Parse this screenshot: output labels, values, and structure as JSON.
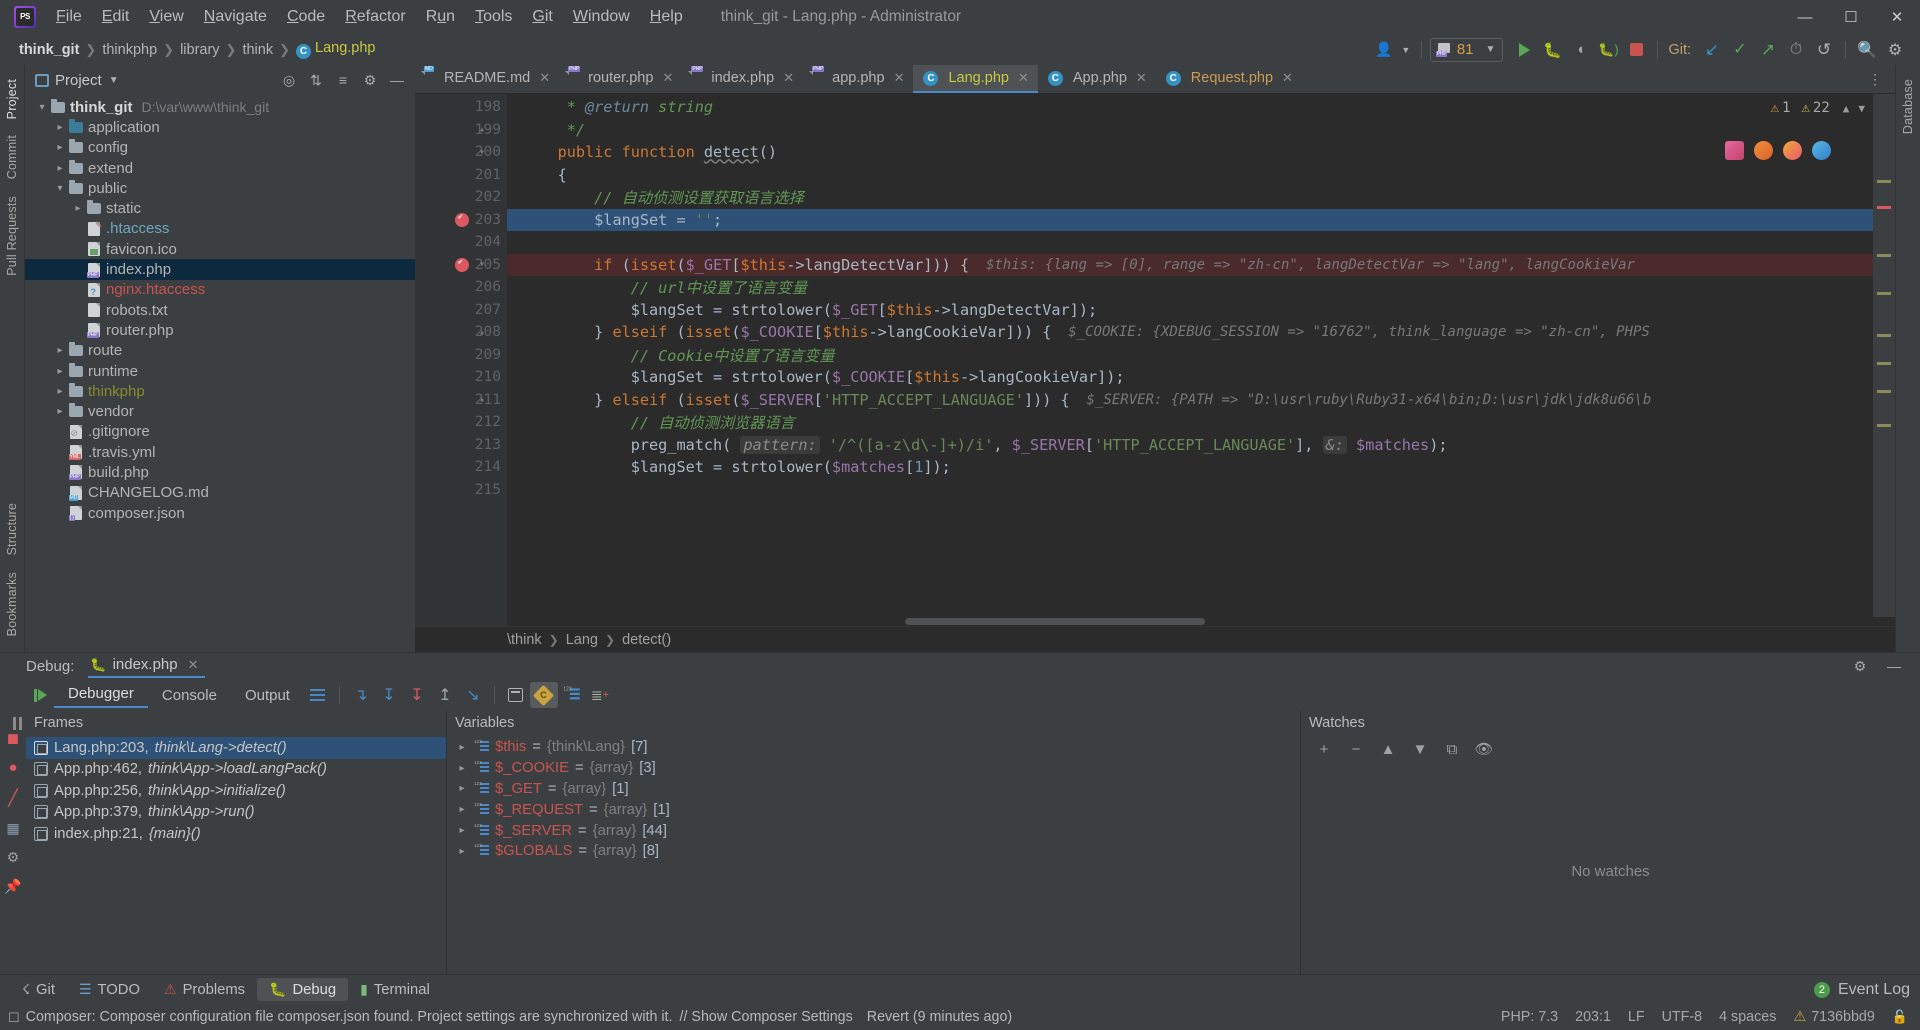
{
  "window": {
    "title": "think_git - Lang.php - Administrator",
    "controls": [
      "minimize",
      "maximize",
      "close"
    ]
  },
  "menu": [
    "File",
    "Edit",
    "View",
    "Navigate",
    "Code",
    "Refactor",
    "Run",
    "Tools",
    "Git",
    "Window",
    "Help"
  ],
  "breadcrumb": {
    "items": [
      "think_git",
      "thinkphp",
      "library",
      "think",
      "Lang.php"
    ],
    "file_badge": "C"
  },
  "toolbar": {
    "run_config": "81",
    "git_label": "Git:",
    "icons": [
      "user-avatar-icon",
      "run-icon",
      "debug-icon",
      "coverage-icon",
      "profile-icon",
      "stop-icon",
      "git-update-icon",
      "git-commit-icon",
      "git-push-icon",
      "history-icon",
      "rollback-icon",
      "search-icon",
      "settings-icon"
    ]
  },
  "left_strip": [
    "Project",
    "Commit",
    "Pull Requests"
  ],
  "right_strip": [
    "Database"
  ],
  "bottom_left_strip": [
    "Structure",
    "Bookmarks"
  ],
  "project_panel": {
    "title": "Project",
    "tree": [
      {
        "depth": 0,
        "chev": "open",
        "icon": "folder",
        "label": "think_git",
        "style": "bold",
        "path": "D:\\var\\www\\think_git"
      },
      {
        "depth": 1,
        "chev": "closed",
        "icon": "folder-blue",
        "label": "application",
        "style": ""
      },
      {
        "depth": 1,
        "chev": "closed",
        "icon": "folder",
        "label": "config",
        "style": ""
      },
      {
        "depth": 1,
        "chev": "closed",
        "icon": "folder",
        "label": "extend",
        "style": ""
      },
      {
        "depth": 1,
        "chev": "open",
        "icon": "folder",
        "label": "public",
        "style": ""
      },
      {
        "depth": 2,
        "chev": "closed",
        "icon": "folder",
        "label": "static",
        "style": ""
      },
      {
        "depth": 2,
        "chev": "none",
        "icon": "file-htaccess",
        "label": ".htaccess",
        "style": "cyan"
      },
      {
        "depth": 2,
        "chev": "none",
        "icon": "file-img",
        "label": "favicon.ico",
        "style": ""
      },
      {
        "depth": 2,
        "chev": "none",
        "icon": "file-php",
        "label": "index.php",
        "style": "",
        "selected": true
      },
      {
        "depth": 2,
        "chev": "none",
        "icon": "file-unknown",
        "label": "nginx.htaccess",
        "style": "red"
      },
      {
        "depth": 2,
        "chev": "none",
        "icon": "file-txt",
        "label": "robots.txt",
        "style": ""
      },
      {
        "depth": 2,
        "chev": "none",
        "icon": "file-php",
        "label": "router.php",
        "style": ""
      },
      {
        "depth": 1,
        "chev": "closed",
        "icon": "folder",
        "label": "route",
        "style": ""
      },
      {
        "depth": 1,
        "chev": "closed",
        "icon": "folder",
        "label": "runtime",
        "style": ""
      },
      {
        "depth": 1,
        "chev": "closed",
        "icon": "folder",
        "label": "thinkphp",
        "style": "yellow"
      },
      {
        "depth": 1,
        "chev": "closed",
        "icon": "folder",
        "label": "vendor",
        "style": ""
      },
      {
        "depth": 1,
        "chev": "none",
        "icon": "file-git",
        "label": ".gitignore",
        "style": ""
      },
      {
        "depth": 1,
        "chev": "none",
        "icon": "file-yml",
        "label": ".travis.yml",
        "style": ""
      },
      {
        "depth": 1,
        "chev": "none",
        "icon": "file-php",
        "label": "build.php",
        "style": ""
      },
      {
        "depth": 1,
        "chev": "none",
        "icon": "file-md",
        "label": "CHANGELOG.md",
        "style": ""
      },
      {
        "depth": 1,
        "chev": "none",
        "icon": "file-json",
        "label": "composer.json",
        "style": ""
      }
    ]
  },
  "editor": {
    "tabs": [
      {
        "label": "README.md",
        "icon": "file-md",
        "color": "default",
        "active": false
      },
      {
        "label": "router.php",
        "icon": "file-php",
        "color": "default",
        "active": false
      },
      {
        "label": "index.php",
        "icon": "file-php",
        "color": "default",
        "active": false
      },
      {
        "label": "app.php",
        "icon": "file-php",
        "color": "default",
        "active": false
      },
      {
        "label": "Lang.php",
        "icon": "class-c",
        "color": "yellow",
        "active": true
      },
      {
        "label": "App.php",
        "icon": "class-c",
        "color": "default",
        "active": false
      },
      {
        "label": "Request.php",
        "icon": "class-c",
        "color": "orange",
        "active": false
      }
    ],
    "inspection": {
      "warnings": "1",
      "weak_warnings": "22"
    },
    "first_line": 198,
    "lines": [
      {
        "n": 198,
        "fold": "",
        "bp": false,
        "state": "",
        "tokens": [
          {
            "t": "     * ",
            "c": "cmt"
          },
          {
            "t": "@return",
            "c": "hint-k"
          },
          {
            "t": " string",
            "c": "cmt"
          }
        ]
      },
      {
        "n": 199,
        "fold": "end",
        "bp": false,
        "state": "",
        "tokens": [
          {
            "t": "     */",
            "c": "cmt"
          }
        ]
      },
      {
        "n": 200,
        "fold": "start",
        "bp": false,
        "state": "",
        "tokens": [
          {
            "t": "    ",
            "c": "txt"
          },
          {
            "t": "public function ",
            "c": "k"
          },
          {
            "t": "detect",
            "c": "fn-und"
          },
          {
            "t": "()",
            "c": "txt"
          }
        ]
      },
      {
        "n": 201,
        "fold": "",
        "bp": false,
        "state": "",
        "tokens": [
          {
            "t": "    {",
            "c": "txt"
          }
        ]
      },
      {
        "n": 202,
        "fold": "",
        "bp": false,
        "state": "",
        "tokens": [
          {
            "t": "        // 自动侦测设置获取语言选择",
            "c": "cmt"
          }
        ]
      },
      {
        "n": 203,
        "fold": "",
        "bp": true,
        "state": "cur",
        "tokens": [
          {
            "t": "        ",
            "c": "txt"
          },
          {
            "t": "$langSet",
            "c": "txt"
          },
          {
            "t": " = ",
            "c": "txt"
          },
          {
            "t": "''",
            "c": "str"
          },
          {
            "t": ";",
            "c": "txt"
          }
        ]
      },
      {
        "n": 204,
        "fold": "",
        "bp": false,
        "state": "",
        "tokens": []
      },
      {
        "n": 205,
        "fold": "start",
        "bp": true,
        "state": "exec",
        "tokens": [
          {
            "t": "        ",
            "c": "txt"
          },
          {
            "t": "if",
            "c": "k"
          },
          {
            "t": " (",
            "c": "txt"
          },
          {
            "t": "isset",
            "c": "k"
          },
          {
            "t": "(",
            "c": "txt"
          },
          {
            "t": "$_GET",
            "c": "var"
          },
          {
            "t": "[",
            "c": "txt"
          },
          {
            "t": "$this",
            "c": "k"
          },
          {
            "t": "->langDetectVar])) {",
            "c": "txt"
          },
          {
            "t": "  $this: {lang => [0], range => \"zh-cn\", langDetectVar => \"lang\", langCookieVar",
            "c": "hint"
          }
        ]
      },
      {
        "n": 206,
        "fold": "",
        "bp": false,
        "state": "",
        "tokens": [
          {
            "t": "            // url中设置了语言变量",
            "c": "cmt"
          }
        ]
      },
      {
        "n": 207,
        "fold": "",
        "bp": false,
        "state": "",
        "tokens": [
          {
            "t": "            ",
            "c": "txt"
          },
          {
            "t": "$langSet",
            "c": "txt"
          },
          {
            "t": " = ",
            "c": "txt"
          },
          {
            "t": "strtolower",
            "c": "txt"
          },
          {
            "t": "(",
            "c": "txt"
          },
          {
            "t": "$_GET",
            "c": "var"
          },
          {
            "t": "[",
            "c": "txt"
          },
          {
            "t": "$this",
            "c": "k"
          },
          {
            "t": "->langDetectVar]);",
            "c": "txt"
          }
        ]
      },
      {
        "n": 208,
        "fold": "end",
        "bp": false,
        "state": "",
        "tokens": [
          {
            "t": "        } ",
            "c": "txt"
          },
          {
            "t": "elseif",
            "c": "k"
          },
          {
            "t": " (",
            "c": "txt"
          },
          {
            "t": "isset",
            "c": "k"
          },
          {
            "t": "(",
            "c": "txt"
          },
          {
            "t": "$_COOKIE",
            "c": "var"
          },
          {
            "t": "[",
            "c": "txt"
          },
          {
            "t": "$this",
            "c": "k"
          },
          {
            "t": "->langCookieVar])) {",
            "c": "txt"
          },
          {
            "t": "  $_COOKIE: {XDEBUG_SESSION => \"16762\", think_language => \"zh-cn\", PHPS",
            "c": "hint"
          }
        ]
      },
      {
        "n": 209,
        "fold": "",
        "bp": false,
        "state": "",
        "tokens": [
          {
            "t": "            // Cookie中设置了语言变量",
            "c": "cmt"
          }
        ]
      },
      {
        "n": 210,
        "fold": "",
        "bp": false,
        "state": "",
        "tokens": [
          {
            "t": "            ",
            "c": "txt"
          },
          {
            "t": "$langSet",
            "c": "txt"
          },
          {
            "t": " = ",
            "c": "txt"
          },
          {
            "t": "strtolower",
            "c": "txt"
          },
          {
            "t": "(",
            "c": "txt"
          },
          {
            "t": "$_COOKIE",
            "c": "var"
          },
          {
            "t": "[",
            "c": "txt"
          },
          {
            "t": "$this",
            "c": "k"
          },
          {
            "t": "->langCookieVar]);",
            "c": "txt"
          }
        ]
      },
      {
        "n": 211,
        "fold": "end",
        "bp": false,
        "state": "",
        "tokens": [
          {
            "t": "        } ",
            "c": "txt"
          },
          {
            "t": "elseif",
            "c": "k"
          },
          {
            "t": " (",
            "c": "txt"
          },
          {
            "t": "isset",
            "c": "k"
          },
          {
            "t": "(",
            "c": "txt"
          },
          {
            "t": "$_SERVER",
            "c": "var"
          },
          {
            "t": "[",
            "c": "txt"
          },
          {
            "t": "'HTTP_ACCEPT_LANGUAGE'",
            "c": "str"
          },
          {
            "t": "])) {",
            "c": "txt"
          },
          {
            "t": "  $_SERVER: {PATH => \"D:\\usr\\ruby\\Ruby31-x64\\bin;D:\\usr\\jdk\\jdk8u66\\b",
            "c": "hint"
          }
        ]
      },
      {
        "n": 212,
        "fold": "",
        "bp": false,
        "state": "",
        "tokens": [
          {
            "t": "            // 自动侦测浏览器语言",
            "c": "cmt"
          }
        ]
      },
      {
        "n": 213,
        "fold": "",
        "bp": false,
        "state": "",
        "tokens": [
          {
            "t": "            ",
            "c": "txt"
          },
          {
            "t": "preg_match",
            "c": "txt"
          },
          {
            "t": "( ",
            "c": "txt"
          },
          {
            "t": "pattern:",
            "c": "param"
          },
          {
            "t": " ",
            "c": "txt"
          },
          {
            "t": "'/^([a-z\\d\\-]+)/i'",
            "c": "str"
          },
          {
            "t": ", ",
            "c": "txt"
          },
          {
            "t": "$_SERVER",
            "c": "var"
          },
          {
            "t": "[",
            "c": "txt"
          },
          {
            "t": "'HTTP_ACCEPT_LANGUAGE'",
            "c": "str"
          },
          {
            "t": "], ",
            "c": "txt"
          },
          {
            "t": "&:",
            "c": "param"
          },
          {
            "t": " ",
            "c": "txt"
          },
          {
            "t": "$matches",
            "c": "var"
          },
          {
            "t": ");",
            "c": "txt"
          }
        ]
      },
      {
        "n": 214,
        "fold": "",
        "bp": false,
        "state": "",
        "tokens": [
          {
            "t": "            ",
            "c": "txt"
          },
          {
            "t": "$langSet",
            "c": "txt"
          },
          {
            "t": " = ",
            "c": "txt"
          },
          {
            "t": "strtolower",
            "c": "txt"
          },
          {
            "t": "(",
            "c": "txt"
          },
          {
            "t": "$matches",
            "c": "var"
          },
          {
            "t": "[",
            "c": "txt"
          },
          {
            "t": "1",
            "c": "num2"
          },
          {
            "t": "]);",
            "c": "txt"
          }
        ]
      },
      {
        "n": 215,
        "fold": "",
        "bp": false,
        "state": "",
        "tokens": []
      }
    ],
    "status_breadcrumb": [
      "\\think",
      "Lang",
      "detect()"
    ]
  },
  "debug": {
    "label": "Debug:",
    "session_tab": "index.php",
    "tabs": [
      "Debugger",
      "Console",
      "Output"
    ],
    "active_tab": "Debugger",
    "frames_header": "Frames",
    "variables_header": "Variables",
    "watches_header": "Watches",
    "no_watches": "No watches",
    "frames": [
      {
        "file": "Lang.php:203,",
        "fn": "think\\Lang->detect()",
        "selected": true
      },
      {
        "file": "App.php:462,",
        "fn": "think\\App->loadLangPack()",
        "selected": false
      },
      {
        "file": "App.php:256,",
        "fn": "think\\App->initialize()",
        "selected": false
      },
      {
        "file": "App.php:379,",
        "fn": "think\\App->run()",
        "selected": false
      },
      {
        "file": "index.php:21,",
        "fn": "{main}()",
        "selected": false
      }
    ],
    "variables": [
      {
        "name": "$this",
        "type": "{think\\Lang}",
        "count": "[7]"
      },
      {
        "name": "$_COOKIE",
        "type": "{array}",
        "count": "[3]"
      },
      {
        "name": "$_GET",
        "type": "{array}",
        "count": "[1]"
      },
      {
        "name": "$_REQUEST",
        "type": "{array}",
        "count": "[1]"
      },
      {
        "name": "$_SERVER",
        "type": "{array}",
        "count": "[44]"
      },
      {
        "name": "$GLOBALS",
        "type": "{array}",
        "count": "[8]"
      }
    ]
  },
  "bottom_tools": [
    {
      "label": "Git",
      "icon": "git-icon",
      "active": false
    },
    {
      "label": "TODO",
      "icon": "todo-icon",
      "active": false
    },
    {
      "label": "Problems",
      "icon": "problems-icon",
      "active": false
    },
    {
      "label": "Debug",
      "icon": "debug-icon",
      "active": true
    },
    {
      "label": "Terminal",
      "icon": "terminal-icon",
      "active": false
    }
  ],
  "event_log": {
    "label": "Event Log",
    "count": "2"
  },
  "statusbar": {
    "message": "Composer: Composer configuration file composer.json found. Project settings are synchronized with it.",
    "action": "// Show Composer Settings",
    "revert": "Revert (9 minutes ago)",
    "php_version": "PHP: 7.3",
    "caret": "203:1",
    "line_sep": "LF",
    "encoding": "UTF-8",
    "indent": "4 spaces",
    "branch": "7136bbd9"
  },
  "colors": {
    "accent": "#4a88c7",
    "selection": "#2d5177",
    "exec_line": "#4a2a2a",
    "breakpoint": "#db5860",
    "keyword": "#cc7832",
    "string": "#6a8759",
    "comment": "#629755",
    "variable": "#9876aa",
    "error": "#c75450",
    "panel_bg": "#3c3f41",
    "editor_bg": "#2b2b2b"
  }
}
